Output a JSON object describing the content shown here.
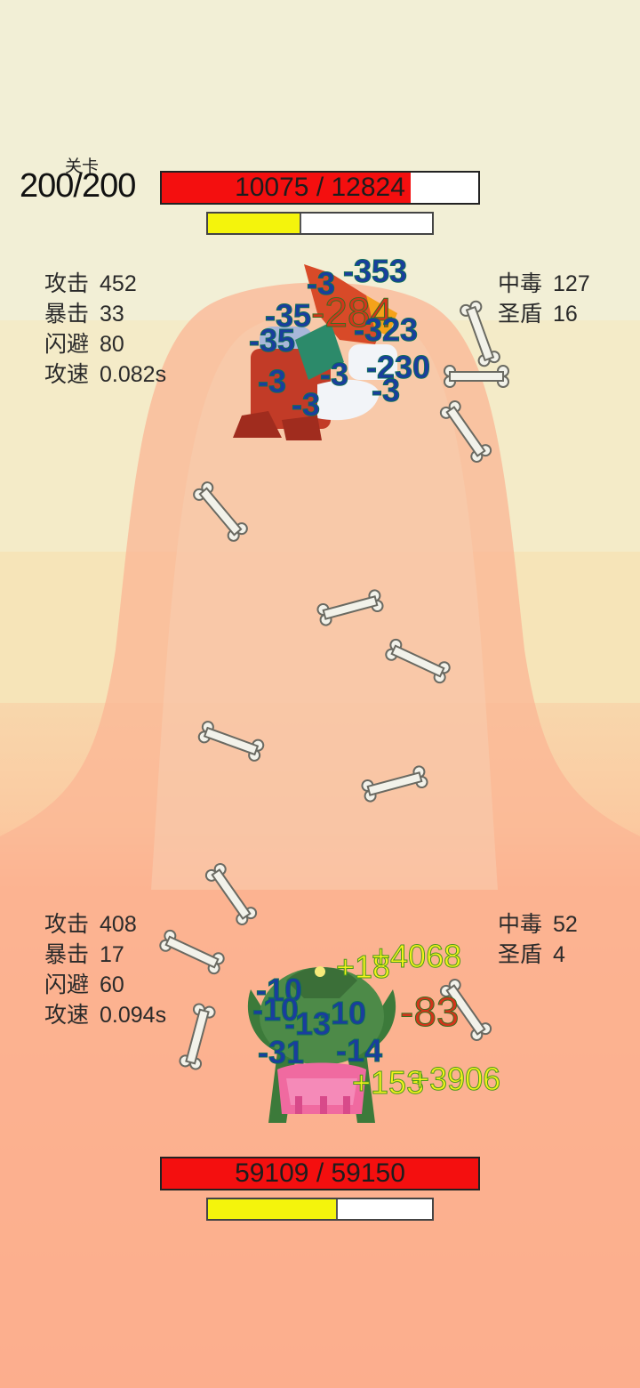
{
  "level": {
    "caption": "关卡",
    "value": "200/200"
  },
  "enemy": {
    "hp_text": "10075 / 12824",
    "hp_fraction": 0.7856,
    "energy_fraction": 0.41,
    "stats_left": [
      {
        "label": "攻击",
        "value": "452"
      },
      {
        "label": "暴击",
        "value": "33"
      },
      {
        "label": "闪避",
        "value": "80"
      },
      {
        "label": "攻速",
        "value": "0.082s"
      }
    ],
    "stats_right": [
      {
        "label": "中毒",
        "value": "127"
      },
      {
        "label": "圣盾",
        "value": "16"
      }
    ],
    "damage_numbers": [
      "-3",
      "-353",
      "-35",
      "-284",
      "-35",
      "-323",
      "-3",
      "-3",
      "-230",
      "-3",
      "-3"
    ]
  },
  "player": {
    "hp_text": "59109 / 59150",
    "hp_fraction": 0.9993,
    "energy_fraction": 0.57,
    "stats_left": [
      {
        "label": "攻击",
        "value": "408"
      },
      {
        "label": "暴击",
        "value": "17"
      },
      {
        "label": "闪避",
        "value": "60"
      },
      {
        "label": "攻速",
        "value": "0.094s"
      }
    ],
    "stats_right": [
      {
        "label": "中毒",
        "value": "52"
      },
      {
        "label": "圣盾",
        "value": "4"
      }
    ],
    "damage_numbers": [
      "-10",
      "-10",
      "-10",
      "-13",
      "-31",
      "-14",
      "-83"
    ],
    "heal_numbers": [
      "+18",
      "+4068",
      "+153",
      "+3906"
    ]
  },
  "colors": {
    "hp_fill": "#f40f0f",
    "energy_fill": "#f4f40c",
    "damage_text": "#1a3d9e",
    "crit_text": "#d4331b",
    "heal_text": "#f4f21c"
  }
}
